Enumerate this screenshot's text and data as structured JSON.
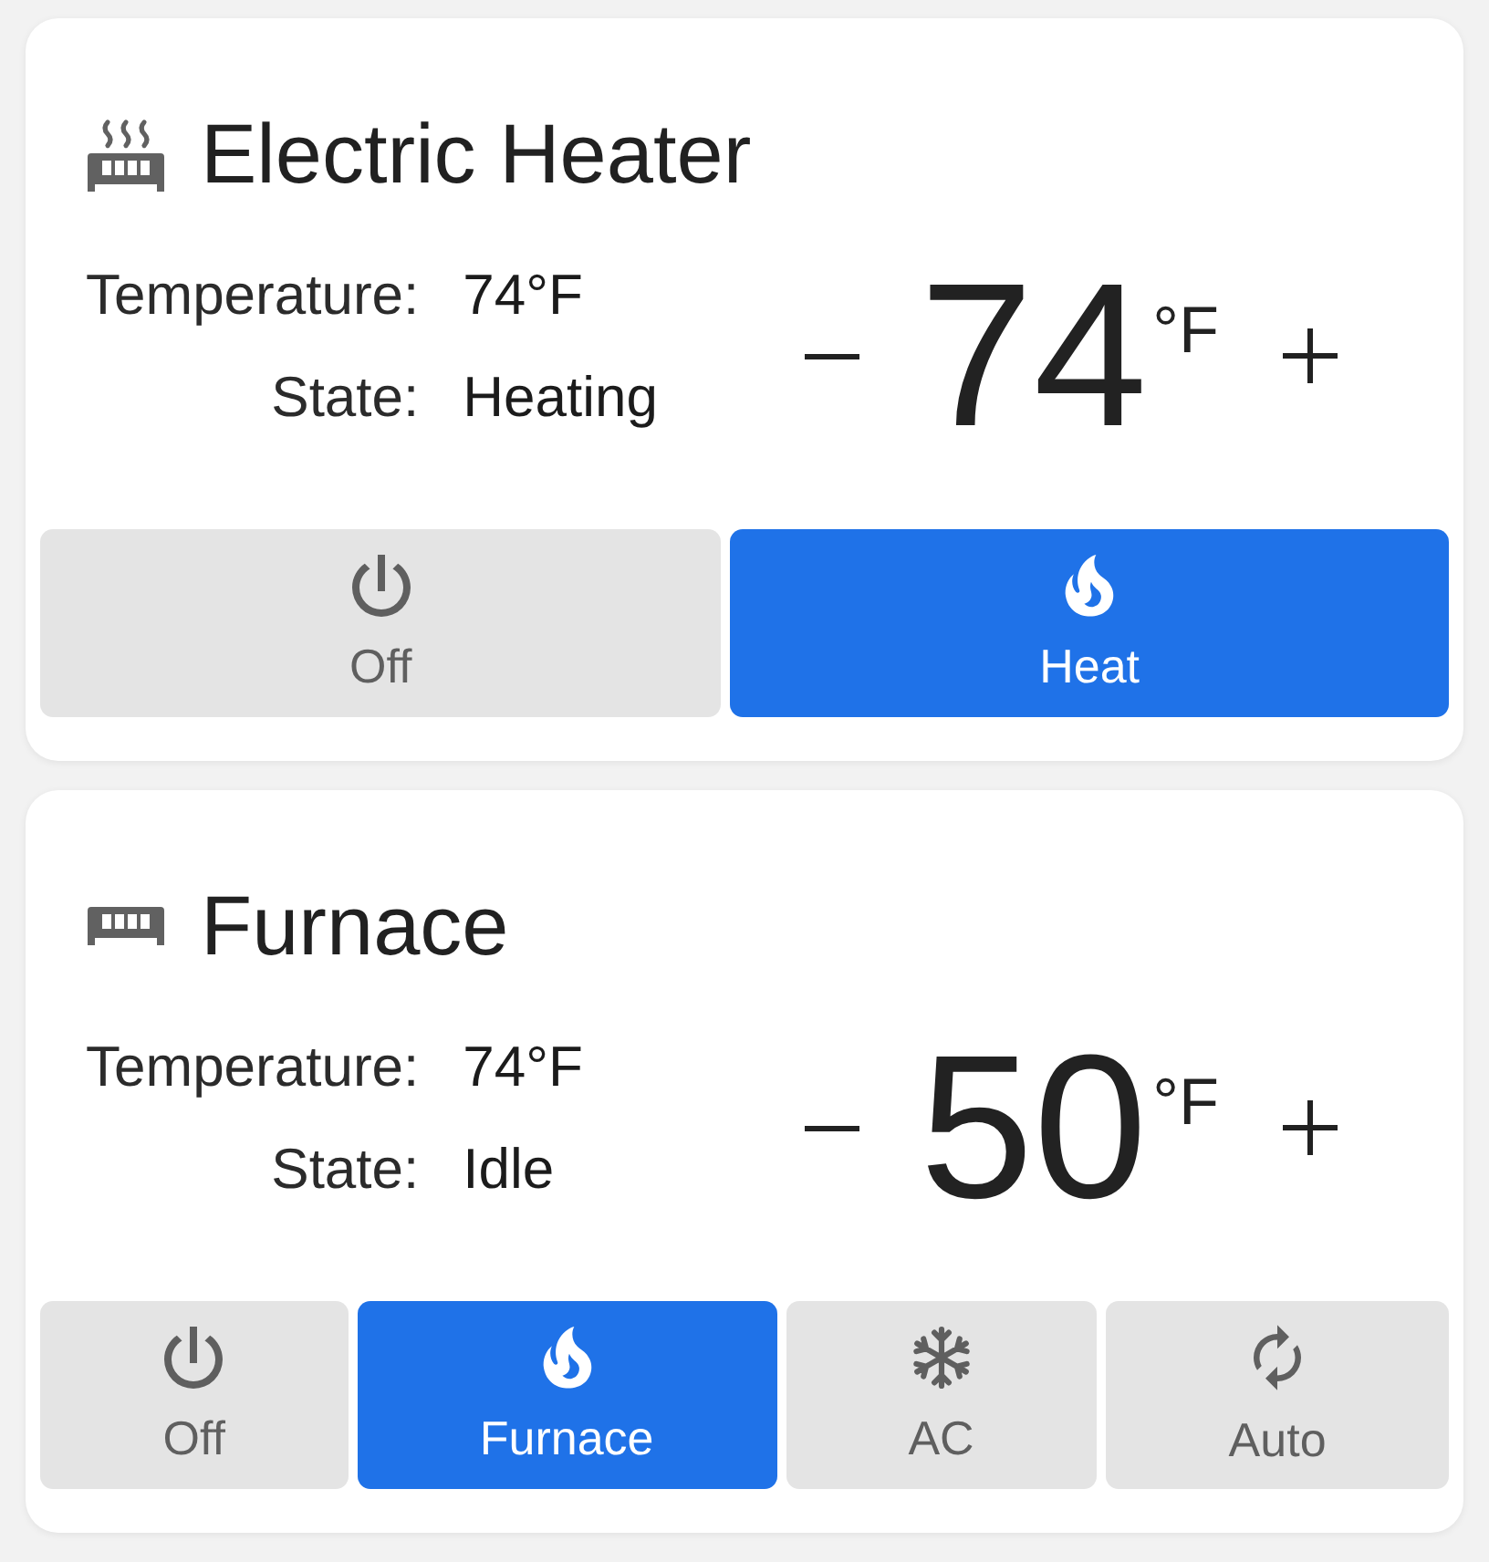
{
  "cards": [
    {
      "kind": "heater",
      "title": "Electric Heater",
      "temperature_label": "Temperature:",
      "temperature": "74°F",
      "state_label": "State:",
      "state": "Heating",
      "setpoint": "74",
      "unit": "°F",
      "modes": [
        {
          "kind": "off",
          "label": "Off",
          "selected": false
        },
        {
          "kind": "heat",
          "label": "Heat",
          "selected": true
        }
      ]
    },
    {
      "kind": "furnace",
      "title": "Furnace",
      "temperature_label": "Temperature:",
      "temperature": "74°F",
      "state_label": "State:",
      "state": "Idle",
      "setpoint": "50",
      "unit": "°F",
      "modes": [
        {
          "kind": "off",
          "label": "Off",
          "selected": false
        },
        {
          "kind": "heat",
          "label": "Furnace",
          "selected": true
        },
        {
          "kind": "cool",
          "label": "AC",
          "selected": false
        },
        {
          "kind": "auto",
          "label": "Auto",
          "selected": false
        }
      ]
    }
  ]
}
